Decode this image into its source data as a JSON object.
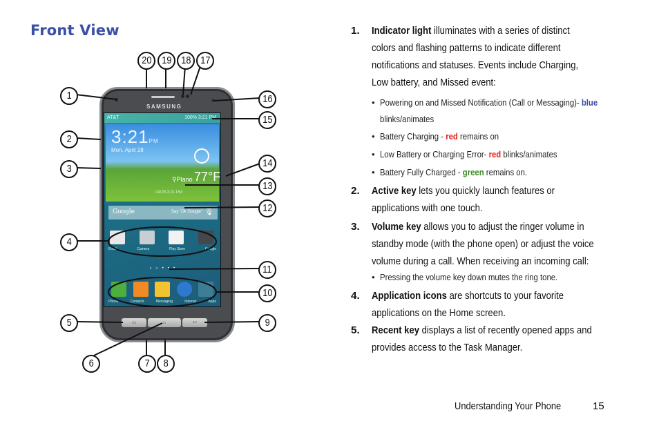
{
  "page": {
    "heading": "Front View",
    "footer_section": "Understanding Your Phone",
    "page_number": "15"
  },
  "phone_screen": {
    "carrier": "AT&T",
    "status_right": "100%  3:21 PM",
    "clock_time": "3:21",
    "clock_ampm": "PM",
    "date": "Mon, April 28",
    "location": "Plano",
    "temperature": "77°F",
    "updated": "04/28 3:21 PM",
    "search_logo": "Google",
    "search_hint": "Say \"Ok Google\"",
    "brand": "SAMSUNG",
    "apps": [
      "Email",
      "Camera",
      "Play Store",
      "Google"
    ],
    "dock": [
      "Phone",
      "Contacts",
      "Messaging",
      "Internet",
      "Apps"
    ],
    "app_colors": [
      "#e8e8e8",
      "#c9cdd4",
      "#f2f2f2",
      "#44474c"
    ],
    "dock_colors": [
      "#4caf3e",
      "#f08a24",
      "#f2c230",
      "#2f78d0",
      "#3e7d96"
    ]
  },
  "callouts": {
    "labels": [
      "1",
      "2",
      "3",
      "4",
      "5",
      "6",
      "7",
      "8",
      "9",
      "10",
      "11",
      "12",
      "13",
      "14",
      "15",
      "16",
      "17",
      "18",
      "19",
      "20"
    ]
  },
  "items": [
    {
      "number": "1.",
      "term": "Indicator light",
      "lines": [
        " illuminates with a series of distinct",
        "colors and flashing patterns to indicate different",
        "notifications and statuses. Events include Charging,",
        "Low battery, and Missed event:"
      ],
      "bullets": [
        {
          "pre": "Powering on and Missed Notification (Call or Messaging)- ",
          "color_word": "blue",
          "post": "",
          "line2": "blinks/animates"
        },
        {
          "pre": "Battery Charging - ",
          "color_word": "red",
          "post": " remains on"
        },
        {
          "pre": "Low Battery or Charging Error- ",
          "color_word": "red",
          "post": " blinks/animates"
        },
        {
          "pre": "Battery Fully Charged - ",
          "color_word": "green",
          "post": " remains on."
        }
      ]
    },
    {
      "number": "2.",
      "term": "Active key",
      "lines": [
        " lets you quickly launch features or",
        "applications with one touch."
      ]
    },
    {
      "number": "3.",
      "term": "Volume key",
      "lines": [
        " allows you to adjust the ringer volume in",
        "standby mode (with the phone open) or adjust the voice",
        "volume during a call. When receiving an incoming call:"
      ],
      "bullets": [
        {
          "text": "Pressing the volume key down mutes the ring tone."
        }
      ]
    },
    {
      "number": "4.",
      "term": "Application icons",
      "lines": [
        " are shortcuts to your favorite",
        "applications on the Home screen."
      ]
    },
    {
      "number": "5.",
      "term": "Recent key",
      "lines": [
        " displays a list of recently opened apps and",
        "provides access to the Task Manager."
      ]
    }
  ],
  "colors": {
    "heading": "#3a4fa6",
    "blue": "#3a4fa6",
    "red": "#e0201b",
    "green": "#3d8a2a"
  }
}
